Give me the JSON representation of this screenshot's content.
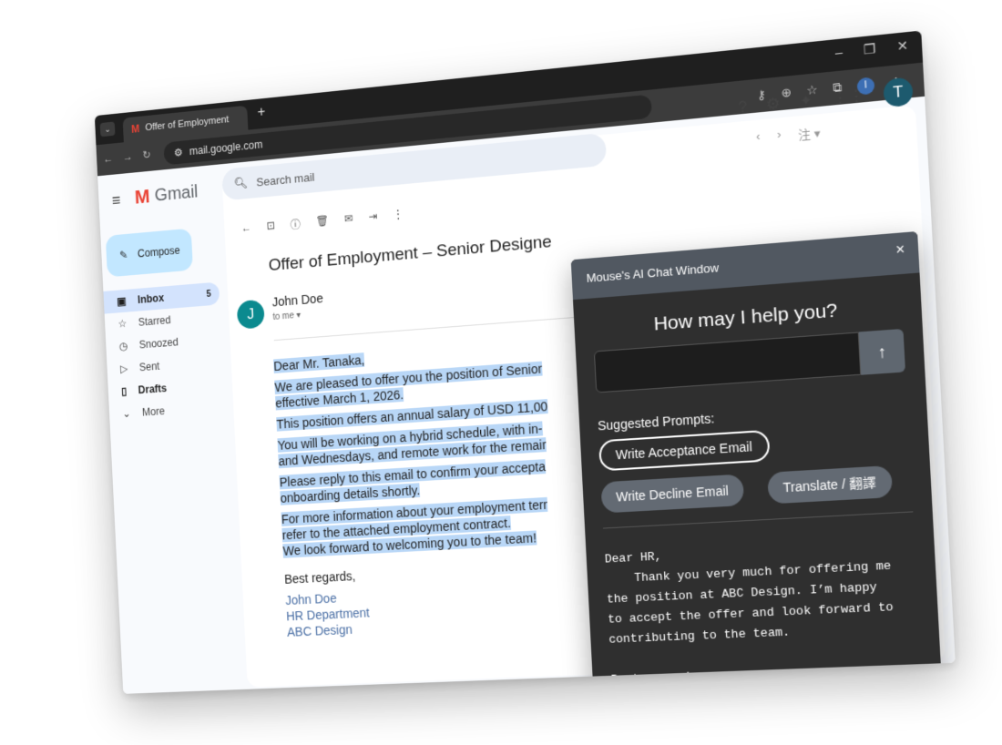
{
  "browser": {
    "tab_title": "Offer of Employment",
    "new_tab": "+",
    "url": "mail.google.com",
    "profile_initial": "I"
  },
  "gmail": {
    "logo": "Gmail",
    "search_placeholder": "Search mail",
    "compose_label": "Compose",
    "nav": [
      {
        "label": "Inbox",
        "count": "5"
      },
      {
        "label": "Starred"
      },
      {
        "label": "Snoozed"
      },
      {
        "label": "Sent"
      },
      {
        "label": "Drafts"
      },
      {
        "label": "More"
      }
    ],
    "account_initial": "T",
    "lang_button": "注 ▾"
  },
  "email": {
    "subject": "Offer of Employment – Senior Designe",
    "sender_initial": "J",
    "sender": "John Doe",
    "to_me": "to me ▾",
    "lines": {
      "greeting": "Dear Mr. Tanaka,",
      "p1a": "We are pleased to offer you the position of Senior",
      "p1b": "effective March 1, 2026.",
      "p2": "This position offers an annual salary of USD 11,00",
      "p3a": "You will be working on a hybrid schedule, with in-",
      "p3b": "and Wednesdays, and remote work for the remair",
      "p4a": "Please reply to this email to confirm your accepta",
      "p4b": "onboarding details shortly.",
      "p5a": "For more information about your employment terr",
      "p5b": "refer to the attached employment contract.",
      "p5c": "We look forward to welcoming you to the team!",
      "closing": "Best regards,",
      "sig1": "John Doe",
      "sig2": "HR Department",
      "sig3": "ABC Design"
    }
  },
  "chat": {
    "title": "Mouse's AI Chat Window",
    "close": "×",
    "heading": "How may I help you?",
    "input_value": "",
    "send_icon": "↑",
    "suggested_label": "Suggested Prompts:",
    "prompts": [
      "Write Acceptance Email",
      "Write Decline Email",
      "Translate / 翻譯"
    ],
    "response": "Dear HR,\n    Thank you very much for offering me\nthe position at ABC Design. I’m happy\nto accept the offer and look forward to\ncontributing to the team.\n\nBest regards,\nIlia Chang"
  }
}
